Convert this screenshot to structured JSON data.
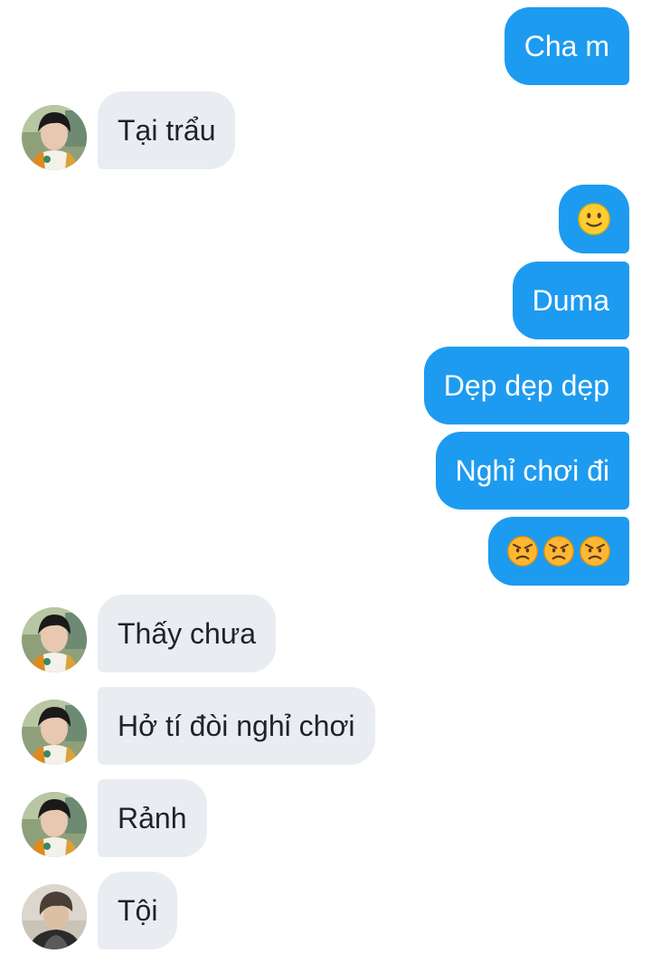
{
  "messages": [
    {
      "side": "out",
      "text": "Cha m"
    },
    {
      "side": "in",
      "text": "Tại trẩu",
      "avatar": "avatar-1"
    },
    {
      "side": "out",
      "emoji": [
        "slightly-smiling-face"
      ]
    },
    {
      "side": "out",
      "text": "Duma"
    },
    {
      "side": "out",
      "text": "Dẹp dẹp dẹp"
    },
    {
      "side": "out",
      "text": "Nghỉ chơi đi"
    },
    {
      "side": "out",
      "emoji": [
        "angry-face",
        "angry-face",
        "angry-face"
      ]
    },
    {
      "side": "in",
      "text": "Thấy chưa",
      "avatar": "avatar-1"
    },
    {
      "side": "in",
      "text": "Hở tí đòi nghỉ chơi",
      "avatar": "avatar-1"
    },
    {
      "side": "in",
      "text": "Rảnh",
      "avatar": "avatar-1"
    },
    {
      "side": "in",
      "text": "Tội",
      "avatar": "avatar-2"
    }
  ],
  "colors": {
    "outgoing_bubble": "#1d9bf0",
    "outgoing_text": "#ffffff",
    "incoming_bubble": "#e9edf1",
    "incoming_text": "#1f2328"
  }
}
